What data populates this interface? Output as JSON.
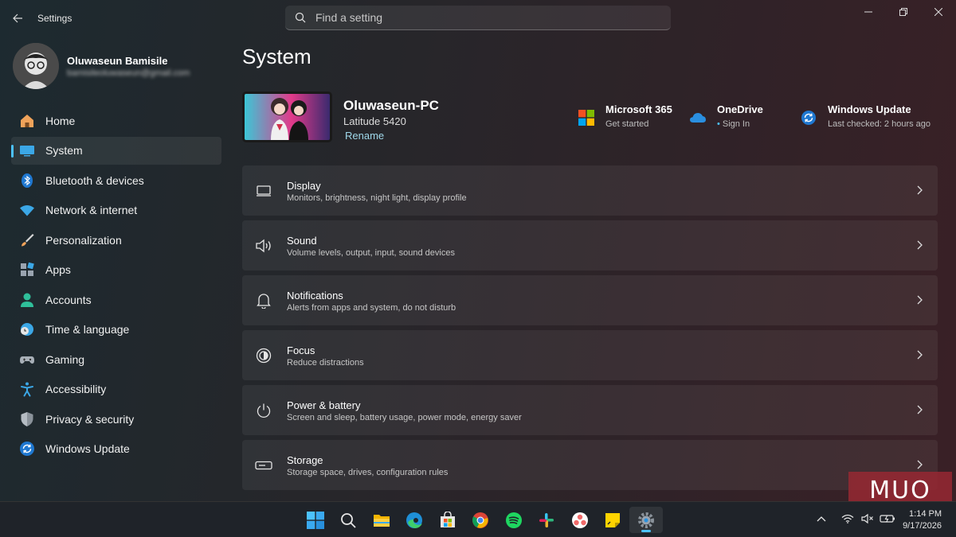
{
  "window": {
    "title": "Settings",
    "search_placeholder": "Find a setting"
  },
  "profile": {
    "name": "Oluwaseun Bamisile",
    "email": "bamisileoluwaseun@gmail.com"
  },
  "sidebar": {
    "items": [
      {
        "label": "Home",
        "icon": "home-icon"
      },
      {
        "label": "System",
        "icon": "system-icon",
        "active": true
      },
      {
        "label": "Bluetooth & devices",
        "icon": "bluetooth-icon"
      },
      {
        "label": "Network & internet",
        "icon": "wifi-icon"
      },
      {
        "label": "Personalization",
        "icon": "brush-icon"
      },
      {
        "label": "Apps",
        "icon": "apps-icon"
      },
      {
        "label": "Accounts",
        "icon": "account-icon"
      },
      {
        "label": "Time & language",
        "icon": "clock-globe-icon"
      },
      {
        "label": "Gaming",
        "icon": "gamepad-icon"
      },
      {
        "label": "Accessibility",
        "icon": "accessibility-icon"
      },
      {
        "label": "Privacy & security",
        "icon": "shield-icon"
      },
      {
        "label": "Windows Update",
        "icon": "update-icon"
      }
    ]
  },
  "main": {
    "title": "System",
    "device": {
      "name": "Oluwaseun-PC",
      "model": "Latitude 5420",
      "rename": "Rename"
    },
    "quick_links": [
      {
        "title": "Microsoft 365",
        "sub": "Get started",
        "icon": "microsoft-365-icon"
      },
      {
        "title": "OneDrive",
        "sub": "Sign In",
        "icon": "onedrive-icon"
      },
      {
        "title": "Windows Update",
        "sub": "Last checked: 2 hours ago",
        "icon": "windows-update-icon"
      }
    ],
    "rows": [
      {
        "title": "Display",
        "sub": "Monitors, brightness, night light, display profile",
        "icon": "display-icon"
      },
      {
        "title": "Sound",
        "sub": "Volume levels, output, input, sound devices",
        "icon": "speaker-icon"
      },
      {
        "title": "Notifications",
        "sub": "Alerts from apps and system, do not disturb",
        "icon": "bell-icon"
      },
      {
        "title": "Focus",
        "sub": "Reduce distractions",
        "icon": "focus-icon"
      },
      {
        "title": "Power & battery",
        "sub": "Screen and sleep, battery usage, power mode, energy saver",
        "icon": "power-icon"
      },
      {
        "title": "Storage",
        "sub": "Storage space, drives, configuration rules",
        "icon": "storage-icon"
      }
    ]
  },
  "taskbar": {
    "apps": [
      "start-icon",
      "search-icon",
      "file-explorer-icon",
      "edge-icon",
      "store-icon",
      "chrome-icon",
      "spotify-icon",
      "slack-icon",
      "asana-icon",
      "sticky-notes-icon",
      "settings-icon"
    ],
    "time": "1:14 PM",
    "date": "9/17/2026"
  },
  "watermark": "MUO",
  "colors": {
    "accent": "#4cc2ff",
    "row_bg": "rgba(255,255,255,0.06)",
    "taskbar_bg": "#1f2329"
  }
}
